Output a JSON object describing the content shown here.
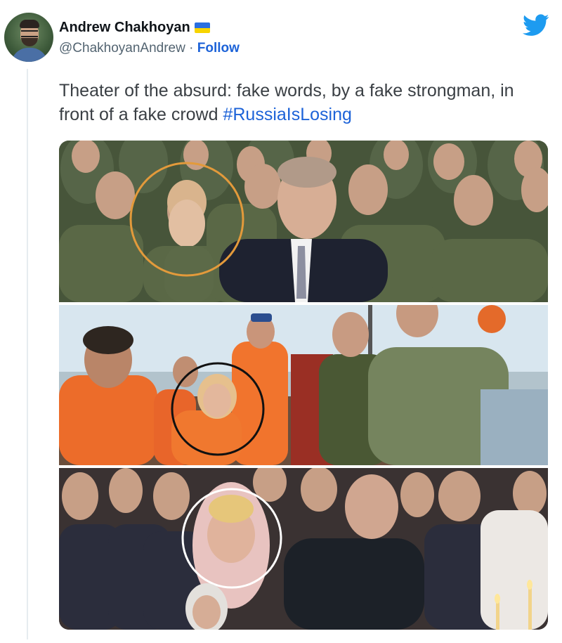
{
  "author": {
    "display_name": "Andrew Chakhoyan",
    "handle": "@ChakhoyanAndrew",
    "separator": "·",
    "follow_label": "Follow",
    "flag_icon": "ukraine-flag-icon"
  },
  "tweet": {
    "text": "Theater of the absurd: fake words, by a fake strongman, in front of a fake crowd ",
    "hashtag": "#RussiaIsLosing"
  },
  "media": {
    "panels": [
      {
        "id": "panel-soldiers",
        "highlight_color": "#e39a3b"
      },
      {
        "id": "panel-boat",
        "highlight_color": "#111111"
      },
      {
        "id": "panel-church",
        "highlight_color": "#ffffff"
      }
    ]
  },
  "colors": {
    "accent": "#1d63d8",
    "twitter_blue": "#1d9bf0",
    "handle_gray": "#536471"
  },
  "icons": {
    "logo": "twitter-bird-icon"
  }
}
